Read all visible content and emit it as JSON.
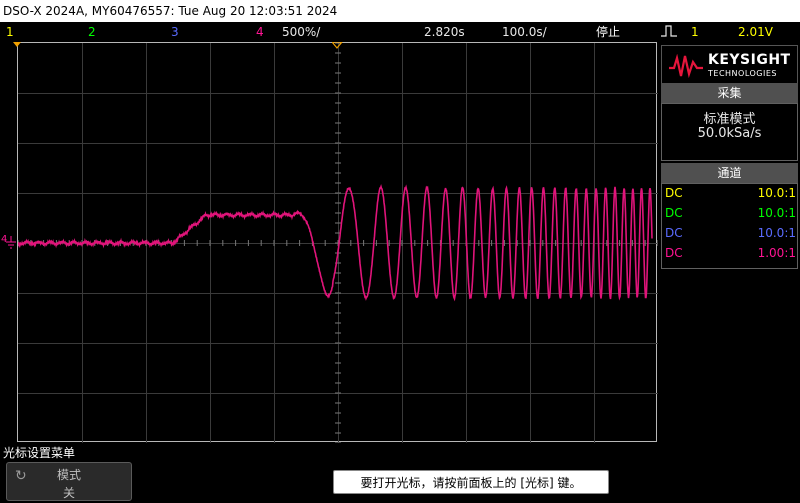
{
  "title_bar": "DSO-X 2024A, MY60476557: Tue Aug 20 12:03:51 2024",
  "status": {
    "ch1": "1",
    "ch2": "2",
    "ch3": "3",
    "ch4": "4",
    "v_scale": "500%/",
    "time": "2.820s",
    "zoom": "100.0s/",
    "run_state": "停止",
    "trigger_icon": "rising-edge-trigger-icon",
    "trigger_source": "1",
    "trigger_level": "2.01V"
  },
  "colors": {
    "ch1": "#ffff00",
    "ch2": "#00ff00",
    "ch3": "#5a6bff",
    "ch4": "#ff1493",
    "trace": "#e0147a",
    "trigger_marker": "#f0a000"
  },
  "logo": {
    "brand": "KEYSIGHT",
    "sub": "TECHNOLOGIES"
  },
  "acquire": {
    "header": "采集",
    "mode": "标准模式",
    "rate": "50.0kSa/s"
  },
  "channels": {
    "header": "通道",
    "rows": [
      {
        "coupling": "DC",
        "probe": "10.0:1"
      },
      {
        "coupling": "DC",
        "probe": "10.0:1"
      },
      {
        "coupling": "DC",
        "probe": "10.0:1"
      },
      {
        "coupling": "DC",
        "probe": "1.00:1"
      }
    ]
  },
  "ground_marker": "4",
  "menu": {
    "title": "光标设置菜单",
    "softkey_label": "模式",
    "softkey_value": "关"
  },
  "message": "要打开光标，请按前面板上的 [光标] 键。"
}
